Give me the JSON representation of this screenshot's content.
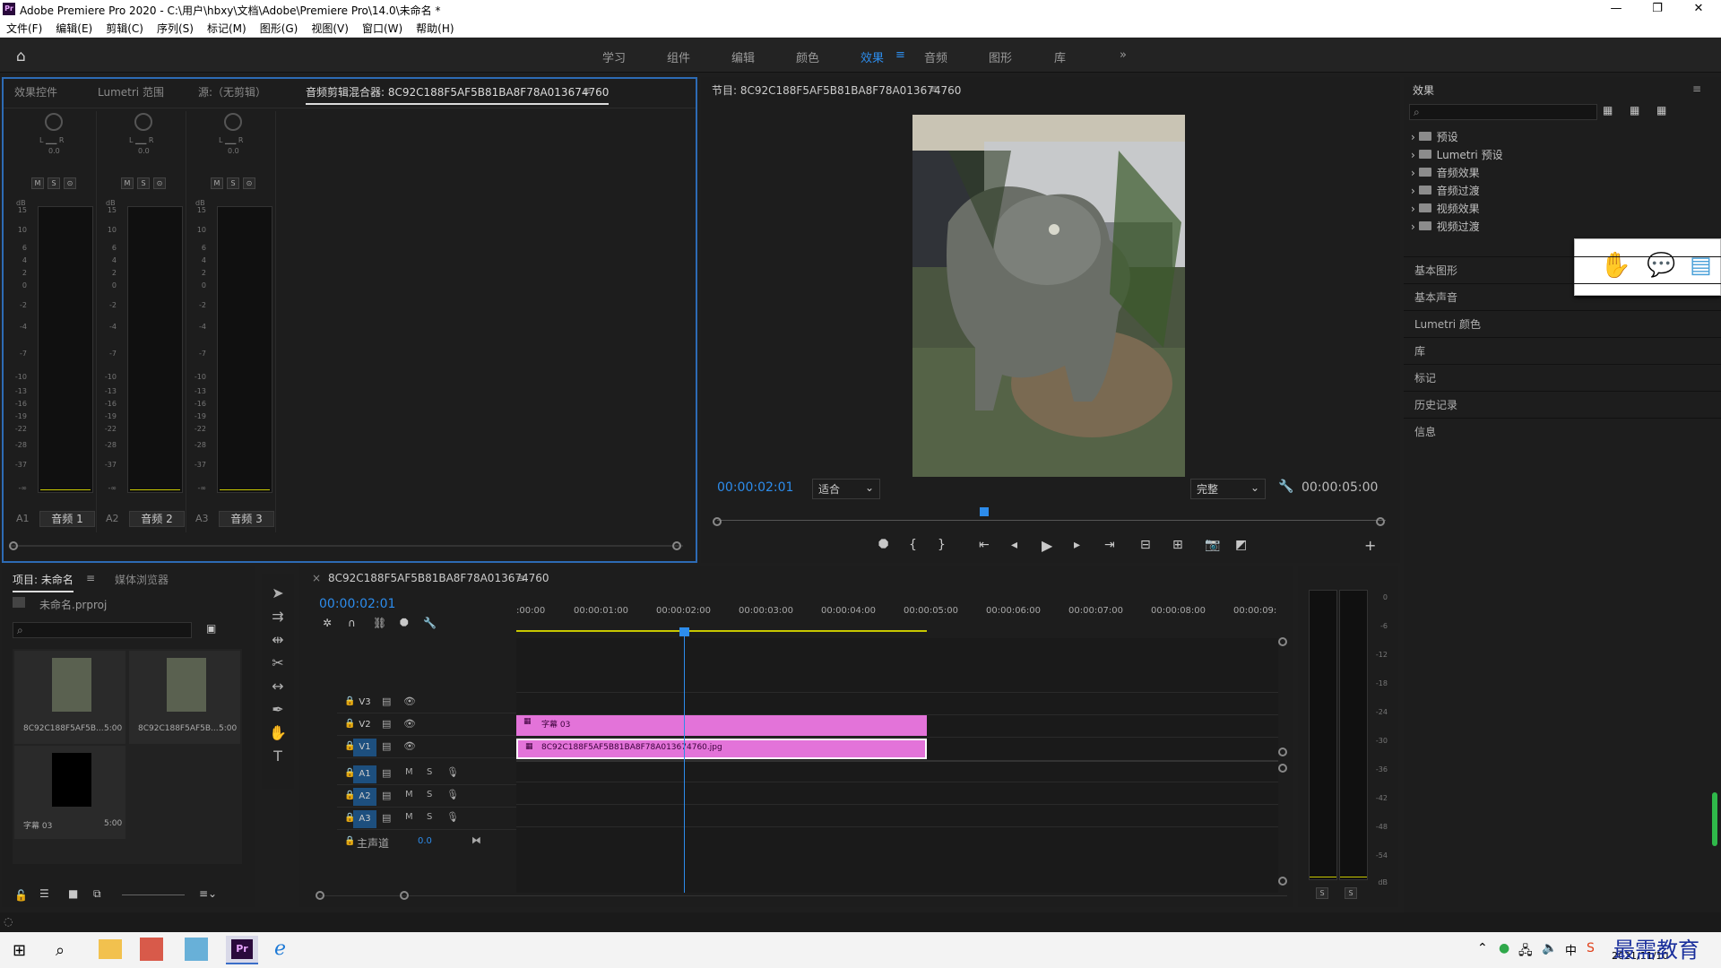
{
  "window": {
    "title": "Adobe Premiere Pro 2020 - C:\\用户\\hbxy\\文档\\Adobe\\Premiere Pro\\14.0\\未命名 *",
    "app_icon": "Pr"
  },
  "menu": [
    "文件(F)",
    "编辑(E)",
    "剪辑(C)",
    "序列(S)",
    "标记(M)",
    "图形(G)",
    "视图(V)",
    "窗口(W)",
    "帮助(H)"
  ],
  "workspaces": {
    "items": [
      "学习",
      "组件",
      "编辑",
      "颜色",
      "效果",
      "音频",
      "图形",
      "库"
    ],
    "active": "效果",
    "more": "»"
  },
  "left_panel": {
    "tabs": [
      "效果控件",
      "Lumetri 范围",
      "源:（无剪辑）",
      "音频剪辑混合器: 8C92C188F5AF5B81BA8F78A013674760"
    ],
    "channels": [
      {
        "id": "A1",
        "name": "音频 1",
        "lr": "L ▁▁ R",
        "val": "0.0"
      },
      {
        "id": "A2",
        "name": "音频 2",
        "lr": "L ▁▁ R",
        "val": "0.0"
      },
      {
        "id": "A3",
        "name": "音频 3",
        "lr": "L ▁▁ R",
        "val": "0.0"
      }
    ],
    "ms": [
      "M",
      "S",
      "⊙"
    ],
    "db_label": "dB",
    "scale": [
      "15",
      "10",
      "6",
      "4",
      "2",
      "0",
      "-2",
      "-4",
      "-7",
      "-10",
      "-13",
      "-16",
      "-19",
      "-22",
      "-28",
      "-37",
      "-∞"
    ]
  },
  "program": {
    "title": "节目: 8C92C188F5AF5B81BA8F78A013674760",
    "timecode": "00:00:02:01",
    "fit": "适合",
    "quality": "完整",
    "duration": "00:00:05:00",
    "playhead_fraction": 0.4
  },
  "effects_panel": {
    "title": "效果",
    "items": [
      "预设",
      "Lumetri 预设",
      "音频效果",
      "音频过渡",
      "视频效果",
      "视频过渡"
    ],
    "side_panels": [
      "基本图形",
      "基本声音",
      "Lumetri 颜色",
      "库",
      "标记",
      "历史记录",
      "信息"
    ]
  },
  "project": {
    "tabs": [
      "项目: 未命名",
      "媒体浏览器"
    ],
    "file": "未命名.prproj",
    "items": [
      {
        "name": "8C92C188F5AF5B...",
        "dur": "5:00"
      },
      {
        "name": "8C92C188F5AF5B...",
        "dur": "5:00"
      },
      {
        "name": "字幕 03",
        "dur": "5:00"
      }
    ]
  },
  "timeline": {
    "tab": "8C92C188F5AF5B81BA8F78A013674760",
    "timecode": "00:00:02:01",
    "ruler": [
      ":00:00",
      "00:00:01:00",
      "00:00:02:00",
      "00:00:03:00",
      "00:00:04:00",
      "00:00:05:00",
      "00:00:06:00",
      "00:00:07:00",
      "00:00:08:00",
      "00:00:09:"
    ],
    "video_tracks": [
      "V3",
      "V2",
      "V1"
    ],
    "audio_tracks": [
      "A1",
      "A2",
      "A3"
    ],
    "master": {
      "label": "主声道",
      "value": "0.0"
    },
    "clips": {
      "v2": "字幕 03",
      "v1": "8C92C188F5AF5B81BA8F78A013674760.jpg"
    },
    "letters": {
      "m": "M",
      "s": "S"
    }
  },
  "audio_meter": {
    "scale": [
      "0",
      "-6",
      "-12",
      "-18",
      "-24",
      "-30",
      "-36",
      "-42",
      "-48",
      "-54",
      "dB"
    ],
    "solo": [
      "S",
      "S"
    ]
  },
  "taskbar": {
    "time": "2021/11/10",
    "ime": "中",
    "watermark": "最需教育"
  }
}
